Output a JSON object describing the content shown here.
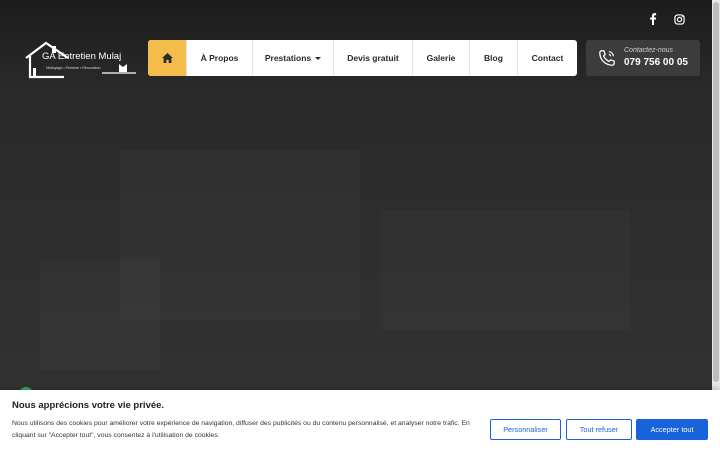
{
  "brand": {
    "name": "GA Entretien Mulaj",
    "tagline": "Nettoyage • Peinture • Rénovation"
  },
  "nav": {
    "items": [
      {
        "label": "",
        "icon": "home-icon"
      },
      {
        "label": "À Propos"
      },
      {
        "label": "Prestations",
        "icon": "caret-down-icon"
      },
      {
        "label": "Devis gratuit"
      },
      {
        "label": "Galerie"
      },
      {
        "label": "Blog"
      },
      {
        "label": "Contact"
      }
    ]
  },
  "social": [
    "facebook-icon",
    "instagram-icon"
  ],
  "contact": {
    "label": "Contactez-nous",
    "phone": "079 756 00 05",
    "icon": "phone-icon"
  },
  "cookie": {
    "title": "Nous apprécions votre vie privée.",
    "text": "Nous utilisons des cookies pour améliorer votre expérience de navigation, diffuser des publicités ou du contenu personnalisé, et analyser notre trafic. En cliquant sur \"Accepter tout\", vous consentez à l'utilisation de cookies.",
    "customize": "Personnaliser",
    "refuse": "Tout refuser",
    "accept": "Accepter tout"
  },
  "colors": {
    "accent": "#f3bc4b",
    "primary": "#1863dc",
    "hero_bg": "#333333"
  }
}
